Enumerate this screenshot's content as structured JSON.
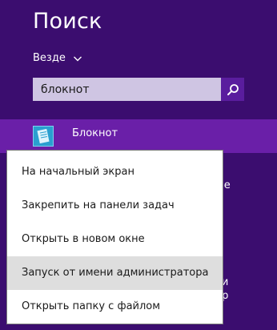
{
  "charm": {
    "title": "Поиск",
    "scope_label": "Везде",
    "search": {
      "value": "блокнот"
    },
    "selected_result": {
      "label": "Блокнот"
    },
    "background_items": [
      "ме",
      "х",
      "ги",
      "ср"
    ]
  },
  "context_menu": {
    "items": [
      "На начальный экран",
      "Закрепить на панели задач",
      "Открыть в новом окне",
      "Запуск от имени администратора",
      "Открыть папку с файлом"
    ],
    "highlighted_index": 3
  },
  "colors": {
    "charm_background": "#3b0d6f",
    "selected_result": "#6a1fa8",
    "search_button": "#5a1d9e",
    "menu_background": "#ffffff",
    "menu_highlight": "#dedede"
  },
  "icons": {
    "search": "magnifier-icon",
    "scope": "chevron-down-icon",
    "app": "notepad-app-icon"
  }
}
